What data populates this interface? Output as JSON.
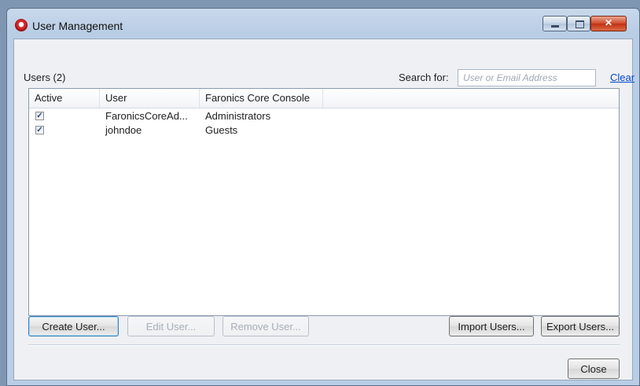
{
  "window": {
    "title": "User Management"
  },
  "header": {
    "users_count": "Users (2)",
    "search_label": "Search for:",
    "search_placeholder": "User or Email Address",
    "search_value": "",
    "clear_link": "Clear"
  },
  "table": {
    "columns": [
      "Active",
      "User",
      "Faronics Core Console"
    ],
    "rows": [
      {
        "active": true,
        "user": "FaronicsCoreAd...",
        "console": "Administrators"
      },
      {
        "active": true,
        "user": "johndoe",
        "console": "Guests"
      }
    ]
  },
  "buttons": {
    "create_user": "Create User...",
    "edit_user": "Edit User...",
    "remove_user": "Remove User...",
    "import_users": "Import Users...",
    "export_users": "Export Users...",
    "close": "Close"
  },
  "icons": {
    "app": "app-icon",
    "minimize": "minimize-icon",
    "maximize": "maximize-icon",
    "close": "close-icon",
    "checkbox": "checkbox-checked-icon"
  },
  "colors": {
    "title_bar": "#b9cde5",
    "close_button": "#c03114",
    "link": "#0044cc",
    "client_background": "#eef0f3"
  }
}
